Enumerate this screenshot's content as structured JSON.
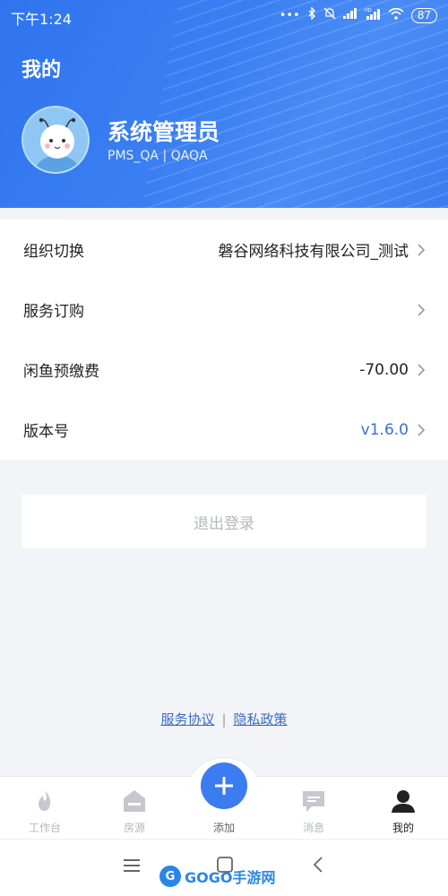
{
  "status_bar": {
    "time": "下午1:24",
    "icons": [
      "dots-icon",
      "bluetooth-icon",
      "mute-icon",
      "signal-icon",
      "hd-signal-icon",
      "wifi-icon"
    ],
    "battery": "87"
  },
  "header": {
    "title": "我的",
    "user_name": "系统管理员",
    "user_sub": "PMS_QA | QAQA"
  },
  "menu": {
    "org_switch": {
      "label": "组织切换",
      "value": "磐谷网络科技有限公司_测试"
    },
    "service_order": {
      "label": "服务订购",
      "value": ""
    },
    "prepaid_fee": {
      "label": "闲鱼预缴费",
      "value": "-70.00"
    },
    "version": {
      "label": "版本号",
      "value": "v1.6.0"
    }
  },
  "logout_label": "退出登录",
  "agreements": {
    "service_agreement": "服务协议",
    "separator": "|",
    "privacy_policy": "隐私政策"
  },
  "tabs": {
    "workbench": "工作台",
    "listings": "房源",
    "add": "添加",
    "messages": "消息",
    "mine": "我的"
  },
  "watermark": "GOGO手游网",
  "colors": {
    "primary": "#3b7cf0",
    "version_text": "#3a71c9",
    "link": "#3a6cc0"
  }
}
